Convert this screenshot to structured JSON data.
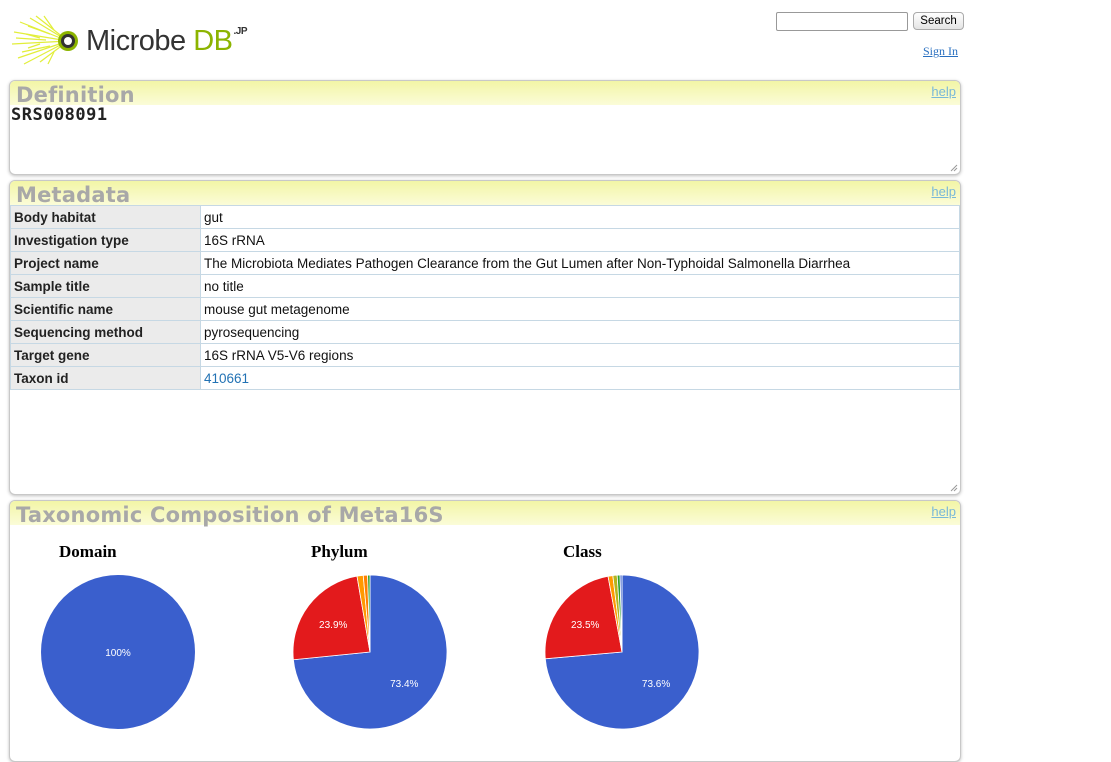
{
  "header": {
    "logo_text": "Microbe",
    "logo_db": "DB",
    "logo_jp": ".JP",
    "search_placeholder": "",
    "search_button": "Search",
    "sign_in": "Sign In"
  },
  "definition": {
    "title": "Definition",
    "help": "help",
    "sample_id": "SRS008091"
  },
  "metadata": {
    "title": "Metadata",
    "help": "help",
    "rows": [
      {
        "key": "Body habitat",
        "value": "gut"
      },
      {
        "key": "Investigation type",
        "value": "16S rRNA"
      },
      {
        "key": "Project name",
        "value": "The Microbiota Mediates Pathogen Clearance from the Gut Lumen after Non-Typhoidal Salmonella Diarrhea"
      },
      {
        "key": "Sample title",
        "value": "no title"
      },
      {
        "key": "Scientific name",
        "value": "mouse gut metagenome"
      },
      {
        "key": "Sequencing method",
        "value": "pyrosequencing"
      },
      {
        "key": "Target gene",
        "value": "16S rRNA V5-V6 regions"
      },
      {
        "key": "Taxon id",
        "value": "410661"
      }
    ]
  },
  "composition": {
    "title": "Taxonomic Composition of Meta16S",
    "help": "help"
  },
  "chart_data": [
    {
      "type": "pie",
      "title": "Domain",
      "values": [
        100
      ],
      "labels": [
        "100%"
      ],
      "colors": [
        "#3a5fcd"
      ]
    },
    {
      "type": "pie",
      "title": "Phylum",
      "values": [
        73.4,
        23.9,
        1.3,
        0.9,
        0.5
      ],
      "labels": [
        "73.4%",
        "23.9%",
        "",
        "",
        ""
      ],
      "colors": [
        "#3a5fcd",
        "#e31a1c",
        "#ff9900",
        "#ff7f00",
        "#2ca02c"
      ]
    },
    {
      "type": "pie",
      "title": "Class",
      "values": [
        73.6,
        23.5,
        1.0,
        0.9,
        0.6,
        0.4
      ],
      "labels": [
        "73.6%",
        "23.5%",
        "",
        "",
        "",
        ""
      ],
      "colors": [
        "#3a5fcd",
        "#e31a1c",
        "#ff9900",
        "#b5b51e",
        "#2ca02c",
        "#3a5fcd"
      ]
    }
  ]
}
